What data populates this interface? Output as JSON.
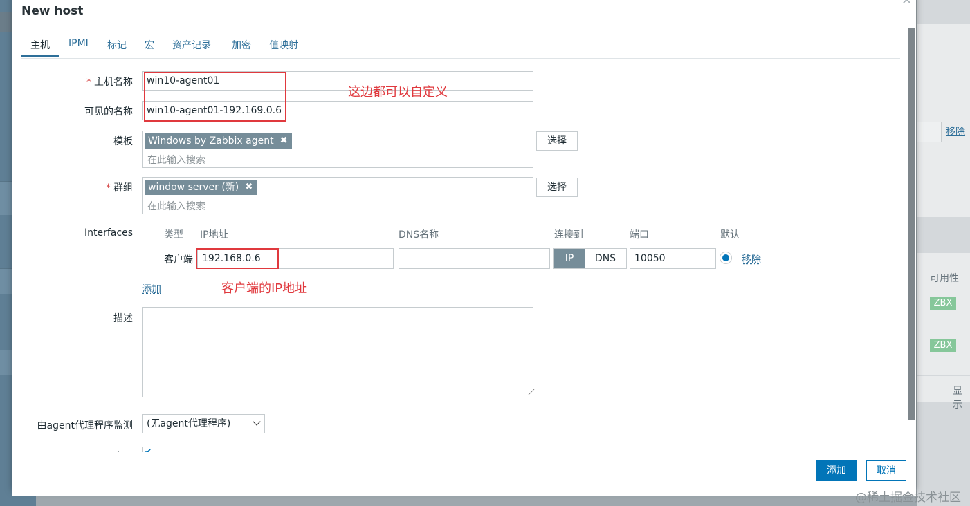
{
  "background": {
    "remove_link": "移除",
    "availability_col": "可用性",
    "badges": [
      "ZBX",
      "ZBX"
    ],
    "display_text": "显示",
    "watermark": "@稀土掘金技术社区"
  },
  "modal": {
    "title": "New host",
    "close_icon": "close-icon",
    "tabs": [
      "主机",
      "IPMI",
      "标记",
      "宏",
      "资产记录",
      "加密",
      "值映射"
    ],
    "active_tab": "主机"
  },
  "form": {
    "host_name": {
      "label": "主机名称",
      "value": "win10-agent01"
    },
    "visible_name": {
      "label": "可见的名称",
      "value": "win10-agent01-192.169.0.6"
    },
    "templates": {
      "label": "模板",
      "chip": "Windows by Zabbix agent",
      "placeholder": "在此输入搜索",
      "select_button": "选择"
    },
    "groups": {
      "label": "群组",
      "chip": "window server (新)",
      "placeholder": "在此输入搜索",
      "select_button": "选择"
    },
    "interfaces": {
      "label": "Interfaces",
      "headers": {
        "type": "类型",
        "ip": "IP地址",
        "dns": "DNS名称",
        "connect_to": "连接到",
        "port": "端口",
        "default": "默认"
      },
      "row": {
        "type": "客户端",
        "ip": "192.168.0.6",
        "dns": "",
        "connect_ip": "IP",
        "connect_dns": "DNS",
        "port": "10050",
        "remove": "移除"
      },
      "add_link": "添加"
    },
    "description": {
      "label": "描述",
      "value": ""
    },
    "monitored_by_proxy": {
      "label": "由agent代理程序监测",
      "value": "(无agent代理程序)"
    },
    "enabled": {
      "label": "已启用",
      "checked": true
    }
  },
  "footer": {
    "add_button": "添加",
    "cancel_button": "取消"
  },
  "annotations": {
    "names_note": "这边都可以自定义",
    "ip_note": "客户端的IP地址",
    "color": "#e0393e"
  }
}
